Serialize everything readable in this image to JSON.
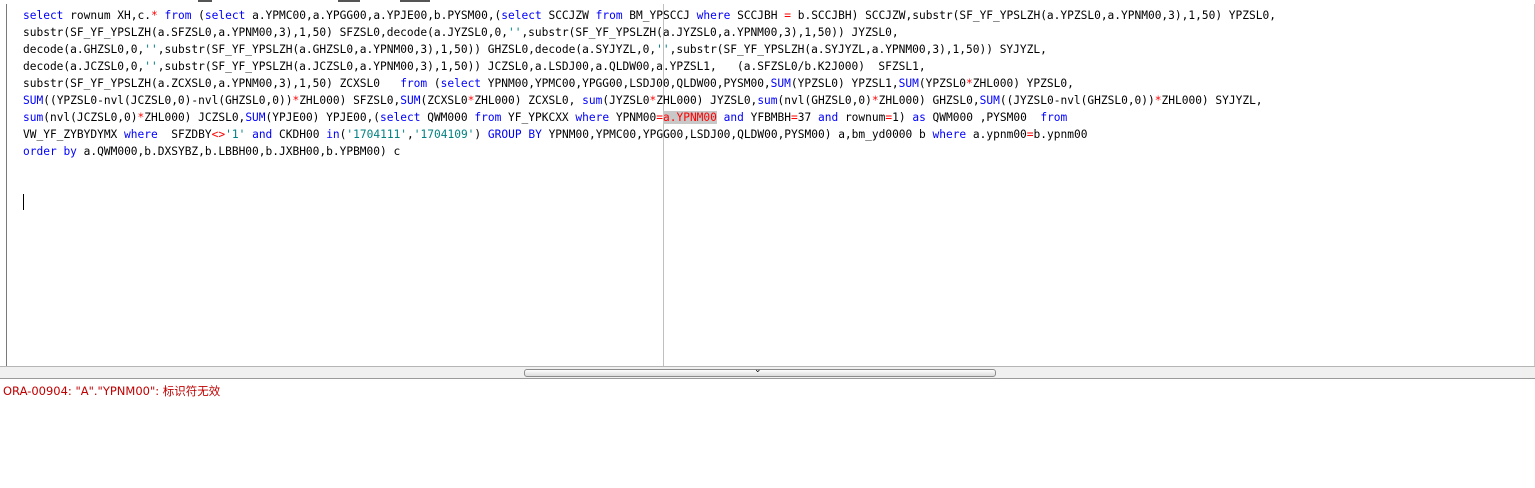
{
  "editor": {
    "lines": [
      "select rownum XH,c.* from (select a.YPMC00,a.YPGG00,a.YPJE00,b.PYSM00,(select SCCJZW from BM_YPSCCJ where SCCJBH = b.SCCJBH) SCCJZW,substr(SF_YF_YPSLZH(a.YPZSL0,a.YPNM00,3),1,50) YPZSL0,",
      "substr(SF_YF_YPSLZH(a.SFZSL0,a.YPNM00,3),1,50) SFZSL0,decode(a.JYZSL0,0,'',substr(SF_YF_YPSLZH(a.JYZSL0,a.YPNM00,3),1,50)) JYZSL0,",
      "decode(a.GHZSL0,0,'',substr(SF_YF_YPSLZH(a.GHZSL0,a.YPNM00,3),1,50)) GHZSL0,decode(a.SYJYZL,0,'',substr(SF_YF_YPSLZH(a.SYJYZL,a.YPNM00,3),1,50)) SYJYZL,",
      "decode(a.JCZSL0,0,'',substr(SF_YF_YPSLZH(a.JCZSL0,a.YPNM00,3),1,50)) JCZSL0,a.LSDJ00,a.QLDW00,a.YPZSL1,   (a.SFZSL0/b.K2J000)  SFZSL1,",
      "substr(SF_YF_YPSLZH(a.ZCXSL0,a.YPNM00,3),1,50) ZCXSL0   from (select YPNM00,YPMC00,YPGG00,LSDJ00,QLDW00,PYSM00,SUM(YPZSL0) YPZSL1,SUM(YPZSL0*ZHL000) YPZSL0,",
      "SUM((YPZSL0-nvl(JCZSL0,0)-nvl(GHZSL0,0))*ZHL000) SFZSL0,SUM(ZCXSL0*ZHL000) ZCXSL0, sum(JYZSL0*ZHL000) JYZSL0,sum(nvl(GHZSL0,0)*ZHL000) GHZSL0,SUM((JYZSL0-nvl(GHZSL0,0))*ZHL000) SYJYZL,",
      "sum(nvl(JCZSL0,0)*ZHL000) JCZSL0,SUM(YPJE00) YPJE00,(select QWM000 from YF_YPKCXX where YPNM00=a.YPNM00 and YFBMBH=37 and rownum=1) as QWM000 ,PYSM00  from",
      "VW_YF_ZYBYDYMX where  SFZDBY<>'1' and CKDH00 in('1704111','1704109') GROUP BY YPNM00,YPMC00,YPGG00,LSDJ00,QLDW00,PYSM00) a,bm_yd0000 b where a.ypnm00=b.ypnm00",
      "order by a.QWM000,b.DXSYBZ,b.LBBH00,b.JXBH00,b.YPBM00) c"
    ],
    "highlighted_text": "a.YPNM00",
    "highlight_line": 6,
    "keywords": [
      "select",
      "from",
      "where",
      "and",
      "in",
      "as",
      "order",
      "by",
      "GROUP",
      "BY"
    ],
    "functions": [
      "SUM",
      "sum"
    ],
    "colors": {
      "keyword": "#0000ff",
      "string": "#008080",
      "operator": "#ff0000",
      "error": "#c00000",
      "highlight_bg": "#c8c8c8"
    }
  },
  "output": {
    "message": "ORA-00904: \"A\".\"YPNM00\": 标识符无效"
  },
  "splitter": {
    "grip_icon": "chevron-down-icon"
  }
}
